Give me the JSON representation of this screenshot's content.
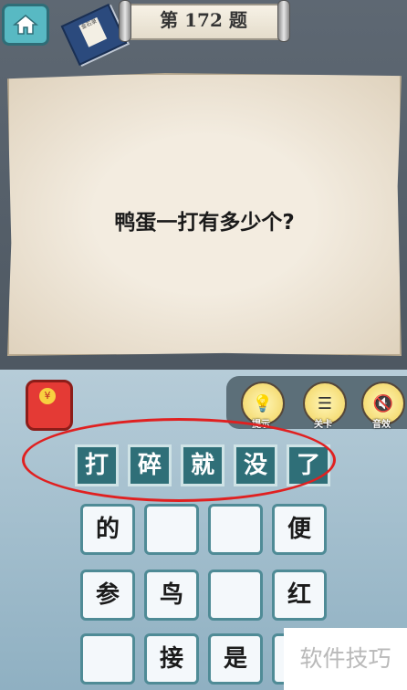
{
  "header": {
    "level_title": "第 172 题",
    "home_icon": "home-icon",
    "book_text": "金石录"
  },
  "question": {
    "text": "鸭蛋一打有多少个?"
  },
  "red_packet": {
    "icon": "yen-icon",
    "symbol": "¥"
  },
  "tools": [
    {
      "label": "提示",
      "icon": "lightbulb-icon"
    },
    {
      "label": "关卡",
      "icon": "scroll-icon"
    },
    {
      "label": "音效",
      "icon": "sound-icon"
    }
  ],
  "answer": [
    "打",
    "碎",
    "就",
    "没",
    "了"
  ],
  "choices": [
    [
      "的",
      "",
      "",
      "便"
    ],
    [
      "参",
      "鸟",
      "",
      "红"
    ],
    [
      "",
      "接",
      "是",
      ""
    ]
  ],
  "watermark": "软件技巧",
  "colors": {
    "answer_tile": "#2f6f78",
    "highlight": "#e02020"
  }
}
